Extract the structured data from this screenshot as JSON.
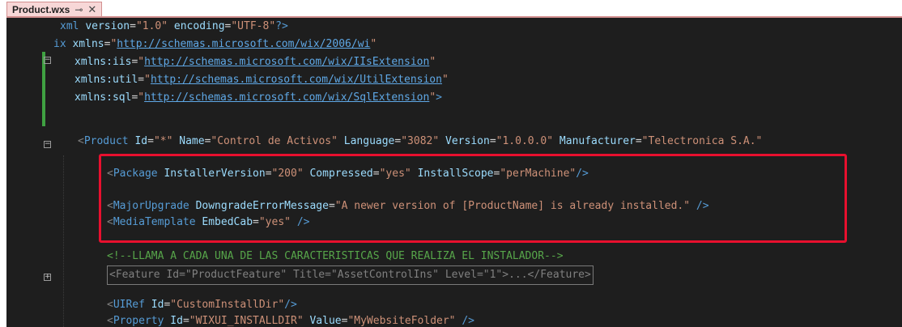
{
  "tab": {
    "title": "Product.wxs",
    "pin_glyph": "⊸",
    "close_glyph": "✕"
  },
  "colors": {
    "editor_bg": "#1e1e1e",
    "tag": "#569cd6",
    "attribute": "#9cdcfe",
    "string": "#ce9178",
    "comment": "#57a64a",
    "highlight_border": "#e8102e",
    "change_bar": "#3fa142"
  },
  "icons": {
    "fold_minus": "−",
    "fold_plus": "+"
  },
  "code": {
    "l1": {
      "xml": "xml",
      "a1": "version",
      "v1": "\"1.0\"",
      "a2": "encoding",
      "v2": "\"UTF-8\"",
      "end": "?>"
    },
    "l2": {
      "tag": "ix",
      "attr": "xmlns",
      "url": "http://schemas.microsoft.com/wix/2006/wi",
      "q": "\""
    },
    "l3": {
      "attr": "xmlns:iis",
      "url": "http://schemas.microsoft.com/wix/IIsExtension",
      "q": "\""
    },
    "l4": {
      "attr": "xmlns:util",
      "url": "http://schemas.microsoft.com/wix/UtilExtension",
      "q": "\""
    },
    "l5": {
      "attr": "xmlns:sql",
      "url": "http://schemas.microsoft.com/wix/SqlExtension",
      "q": "\"",
      "end": ">"
    },
    "l6": {
      "open": "<",
      "tag": "Product",
      "a1": "Id",
      "v1": "\"*\"",
      "a2": "Name",
      "v2": "\"Control de Activos\"",
      "a3": "Language",
      "v3": "\"3082\"",
      "a4": "Version",
      "v4": "\"1.0.0.0\"",
      "a5": "Manufacturer",
      "v5": "\"Telectronica S.A.\""
    },
    "l7": {
      "open": "<",
      "tag": "Package",
      "a1": "InstallerVersion",
      "v1": "\"200\"",
      "a2": "Compressed",
      "v2": "\"yes\"",
      "a3": "InstallScope",
      "v3": "\"perMachine\"",
      "end": "/>"
    },
    "l8": {
      "open": "<",
      "tag": "MajorUpgrade",
      "a1": "DowngradeErrorMessage",
      "v1": "\"A newer version of [ProductName] is already installed.\"",
      "end": "/>"
    },
    "l9": {
      "open": "<",
      "tag": "MediaTemplate",
      "a1": "EmbedCab",
      "v1": "\"yes\"",
      "end": "/>"
    },
    "l10": {
      "comment": "<!--LLAMA A CADA UNA DE LAS CARACTERISTICAS QUE REALIZA EL INSTALADOR-->"
    },
    "l11": {
      "text": "<Feature Id=\"ProductFeature\" Title=\"AssetControlIns\" Level=\"1\">...</Feature>"
    },
    "l12": {
      "open": "<",
      "tag": "UIRef",
      "a1": "Id",
      "v1": "\"CustomInstallDir\"",
      "end": "/>"
    },
    "l13": {
      "open": "<",
      "tag": "Property",
      "a1": "Id",
      "v1": "\"WIXUI_INSTALLDIR\"",
      "a2": "Value",
      "v2": "\"MyWebsiteFolder\"",
      "end": "/>"
    }
  }
}
